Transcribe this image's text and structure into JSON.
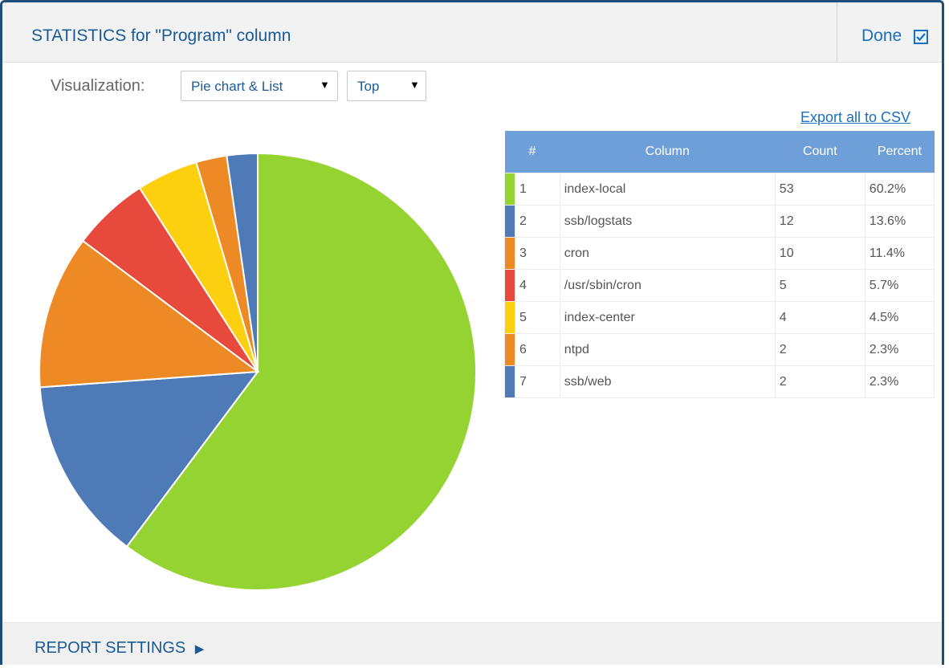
{
  "header": {
    "title": "STATISTICS for \"Program\" column",
    "done_label": "Done"
  },
  "visualization": {
    "label": "Visualization:",
    "type_select": "Pie chart & List",
    "order_select": "Top"
  },
  "export_link": "Export all to CSV",
  "table": {
    "headers": [
      "#",
      "Column",
      "Count",
      "Percent"
    ],
    "rows": [
      {
        "num": "1",
        "column": "index-local",
        "count": "53",
        "percent": "60.2%",
        "color": "#94d332"
      },
      {
        "num": "2",
        "column": "ssb/logstats",
        "count": "12",
        "percent": "13.6%",
        "color": "#4f7ab8"
      },
      {
        "num": "3",
        "column": "cron",
        "count": "10",
        "percent": "11.4%",
        "color": "#ee8a25"
      },
      {
        "num": "4",
        "column": "/usr/sbin/cron",
        "count": "5",
        "percent": "5.7%",
        "color": "#e74a3c"
      },
      {
        "num": "5",
        "column": "index-center",
        "count": "4",
        "percent": "4.5%",
        "color": "#fdd00f"
      },
      {
        "num": "6",
        "column": "ntpd",
        "count": "2",
        "percent": "2.3%",
        "color": "#ee8a25"
      },
      {
        "num": "7",
        "column": "ssb/web",
        "count": "2",
        "percent": "2.3%",
        "color": "#4f7ab8"
      }
    ]
  },
  "chart_data": {
    "type": "pie",
    "categories": [
      "index-local",
      "ssb/logstats",
      "cron",
      "/usr/sbin/cron",
      "index-center",
      "ntpd",
      "ssb/web"
    ],
    "values": [
      53,
      12,
      10,
      5,
      4,
      2,
      2
    ],
    "colors": [
      "#94d332",
      "#4f7ab8",
      "#ee8a25",
      "#e74a3c",
      "#fdd00f",
      "#ee8a25",
      "#4f7ab8"
    ],
    "start": "top, clockwise"
  },
  "footer": {
    "label": "REPORT SETTINGS"
  }
}
